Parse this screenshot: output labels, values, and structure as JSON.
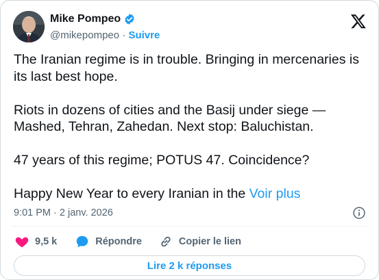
{
  "author": {
    "name": "Mike Pompeo",
    "handle": "@mikepompeo",
    "separator": "·",
    "follow_label": "Suivre"
  },
  "tweet": {
    "paragraphs": [
      "The Iranian regime is in trouble. Bringing in mercenaries is its last best hope.",
      "Riots in dozens of cities and the Basij under siege — Mashed, Tehran, Zahedan.  Next stop:  Baluchistan.",
      "47 years of this regime; POTUS 47.  Coincidence?"
    ],
    "last_line": "Happy New Year to every Iranian in the",
    "see_more": "Voir plus",
    "timestamp": "9:01 PM · 2 janv. 2026"
  },
  "actions": {
    "likes": "9,5 k",
    "reply_label": "Répondre",
    "copy_link_label": "Copier le lien"
  },
  "read_replies_label": "Lire 2 k réponses",
  "icons": [
    "verified-badge-icon",
    "x-logo-icon",
    "info-icon",
    "heart-icon",
    "reply-bubble-icon",
    "link-icon"
  ],
  "colors": {
    "accent": "#1d9bf0",
    "like": "#f91880",
    "text": "#0f1419",
    "muted": "#536471",
    "border": "#cfd9de"
  }
}
